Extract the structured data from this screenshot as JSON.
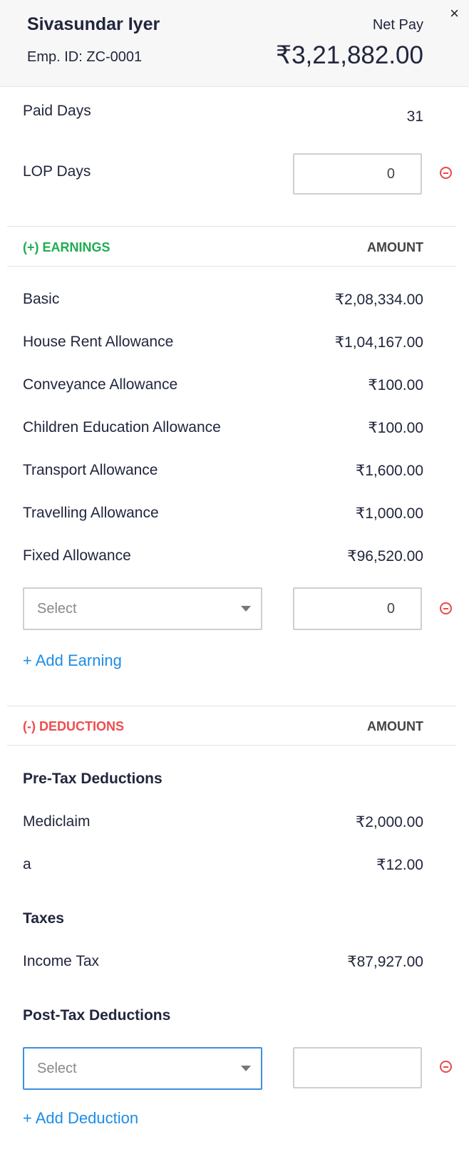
{
  "header": {
    "employee_name": "Sivasundar Iyer",
    "employee_id": "Emp. ID: ZC-0001",
    "net_pay_label": "Net Pay",
    "net_pay_value": "₹3,21,882.00",
    "close_icon": "×"
  },
  "days": {
    "paid_days_label": "Paid Days",
    "paid_days_value": "31",
    "lop_days_label": "LOP Days",
    "lop_days_value": "0"
  },
  "earnings": {
    "heading": "(+) EARNINGS",
    "amount_heading": "AMOUNT",
    "items": [
      {
        "label": "Basic",
        "amount": "₹2,08,334.00"
      },
      {
        "label": "House Rent Allowance",
        "amount": "₹1,04,167.00"
      },
      {
        "label": "Conveyance Allowance",
        "amount": "₹100.00"
      },
      {
        "label": "Children Education Allowance",
        "amount": "₹100.00"
      },
      {
        "label": "Transport Allowance",
        "amount": "₹1,600.00"
      },
      {
        "label": "Travelling Allowance",
        "amount": "₹1,000.00"
      },
      {
        "label": "Fixed Allowance",
        "amount": "₹96,520.00"
      }
    ],
    "new_select_placeholder": "Select",
    "new_amount_value": "0",
    "add_link": "+ Add Earning"
  },
  "deductions": {
    "heading": "(-) DEDUCTIONS",
    "amount_heading": "AMOUNT",
    "pretax_heading": "Pre-Tax Deductions",
    "pretax_items": [
      {
        "label": "Mediclaim",
        "amount": "₹2,000.00"
      },
      {
        "label": "a",
        "amount": "₹12.00"
      }
    ],
    "taxes_heading": "Taxes",
    "tax_items": [
      {
        "label": "Income Tax",
        "amount": "₹87,927.00"
      }
    ],
    "posttax_heading": "Post-Tax Deductions",
    "new_select_placeholder": "Select",
    "new_amount_value": "",
    "add_link": "+ Add Deduction"
  },
  "colors": {
    "earnings": "#1eae52",
    "deductions": "#ef4d4d",
    "link": "#1d8de6",
    "focus": "#3d8fe0"
  },
  "icons": {
    "close": "close-icon",
    "remove": "remove-circle-icon",
    "dropdown": "chevron-down-icon"
  }
}
